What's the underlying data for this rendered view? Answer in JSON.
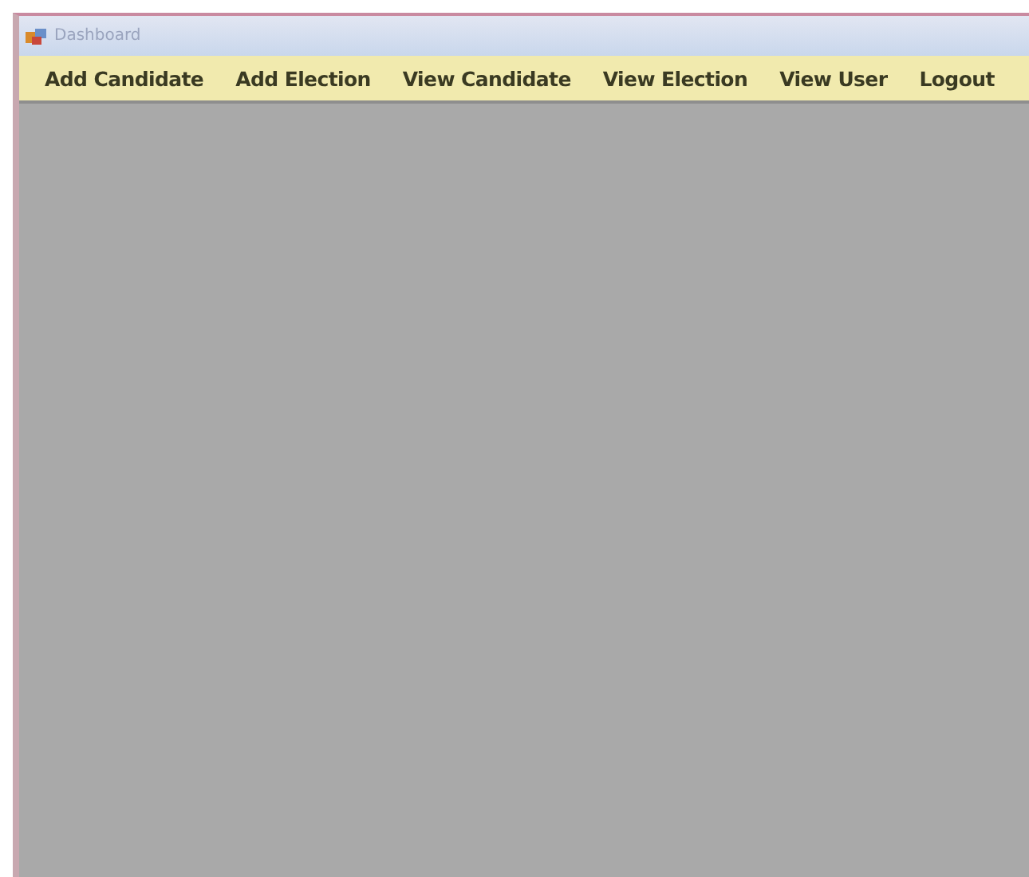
{
  "window": {
    "title": "Dashboard"
  },
  "menu": [
    {
      "label": "Add Candidate"
    },
    {
      "label": "Add Election"
    },
    {
      "label": "View Candidate"
    },
    {
      "label": "View Election"
    },
    {
      "label": "View User"
    },
    {
      "label": "Logout"
    }
  ]
}
